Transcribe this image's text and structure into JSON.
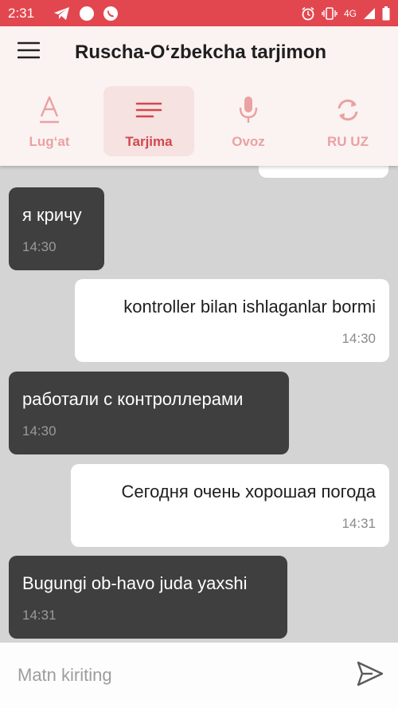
{
  "status_bar": {
    "time": "2:31",
    "network": "4G",
    "icons": [
      "telegram-icon",
      "circle-notification-icon",
      "whatsapp-icon",
      "alarm-icon",
      "vibrate-icon",
      "signal-icon",
      "battery-icon"
    ]
  },
  "app_bar": {
    "title": "Ruscha-O‘zbekcha tarjimon",
    "menu_icon": "hamburger-menu-icon"
  },
  "tabs": [
    {
      "label": "Lug‘at",
      "icon": "text-a-icon",
      "active": false
    },
    {
      "label": "Tarjima",
      "icon": "lines-icon",
      "active": true
    },
    {
      "label": "Ovoz",
      "icon": "microphone-icon",
      "active": false
    },
    {
      "label": "RU UZ",
      "icon": "swap-icon",
      "active": false
    }
  ],
  "messages": [
    {
      "direction": "in",
      "text": "я кричу",
      "time": "14:30"
    },
    {
      "direction": "out",
      "text": "kontroller bilan ishlaganlar bormi",
      "time": "14:30"
    },
    {
      "direction": "in",
      "text": "работали с контроллерами",
      "time": "14:30"
    },
    {
      "direction": "out",
      "text": "Сегодня очень хорошая погода",
      "time": "14:31"
    },
    {
      "direction": "in",
      "text": "Bugungi ob-havo juda yaxshi",
      "time": "14:31"
    }
  ],
  "input": {
    "placeholder": "Matn kiriting",
    "value": "",
    "send_icon": "send-icon"
  },
  "colors": {
    "accent": "#e2474f",
    "tab_active_bg": "#f6e2e0",
    "tab_inactive": "#eaa1a3",
    "incoming_bubble": "#3f3f3f",
    "outgoing_bubble": "#ffffff",
    "chat_bg": "#d4d4d4"
  }
}
